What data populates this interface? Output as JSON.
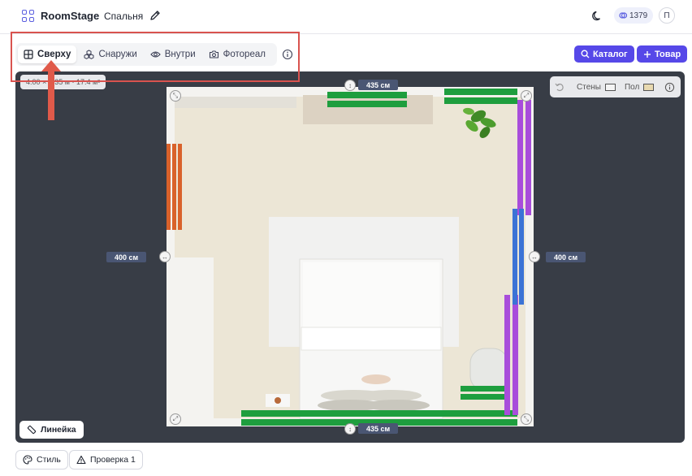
{
  "header": {
    "brand": "RoomStage",
    "room_name": "Спальня",
    "coins": "1379",
    "avatar": "П"
  },
  "view_tabs": [
    {
      "label": "Сверху",
      "icon": "grid-icon",
      "active": true
    },
    {
      "label": "Снаружи",
      "icon": "cubes-icon",
      "active": false
    },
    {
      "label": "Внутри",
      "icon": "eye-icon",
      "active": false
    },
    {
      "label": "Фотореал",
      "icon": "camera-icon",
      "active": false
    }
  ],
  "actions": {
    "catalog": "Каталог",
    "product": "Товар"
  },
  "canvas": {
    "dimensions": "4.00 × 4.35 м · 17.4 м²",
    "toolbar": {
      "walls": "Стены",
      "floor": "Пол"
    },
    "measure_top": "435 см",
    "measure_bottom": "435 см",
    "measure_left": "400 см",
    "measure_right": "400 см",
    "ruler": "Линейка"
  },
  "bottom": {
    "style": "Стиль",
    "check": "Проверка 1"
  },
  "colors": {
    "accent": "#5648e8",
    "highlight": "#d9534f",
    "canvas_bg": "#383d46",
    "green_item": "#1e9e3e",
    "purple_item": "#a84ddb",
    "blue_item": "#3b73d6",
    "orange_item": "#d9622b"
  }
}
